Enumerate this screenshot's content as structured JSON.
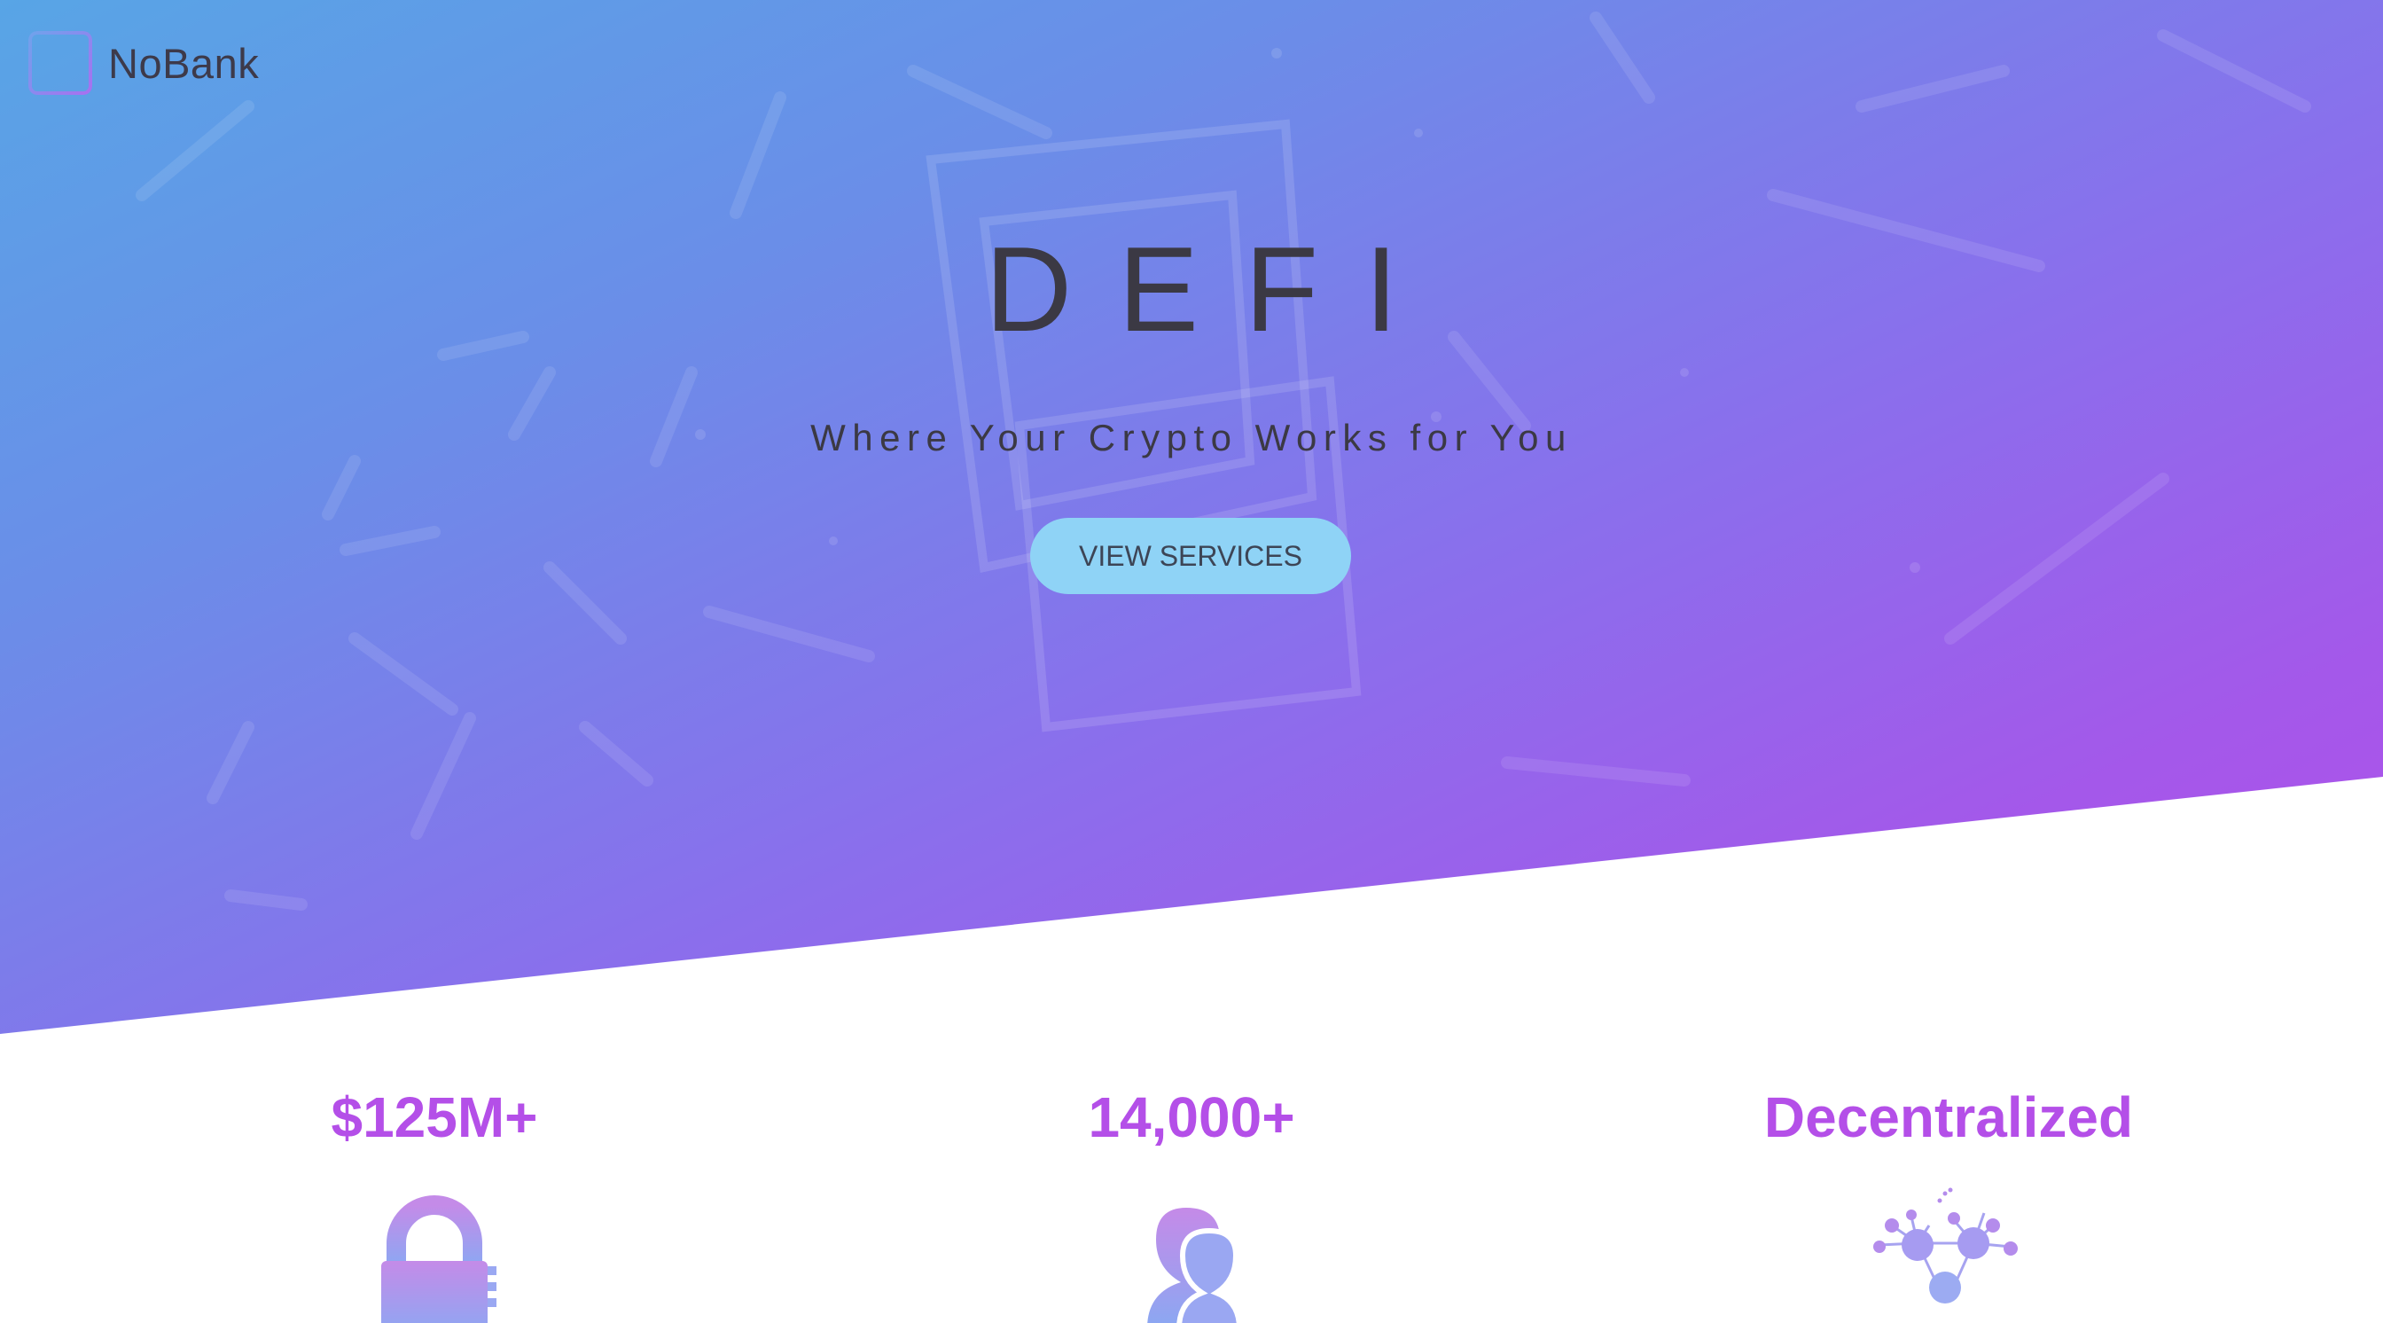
{
  "brand": {
    "name": "NoBank",
    "logo_icon": "rounded-square-outline-icon"
  },
  "hero": {
    "title": "DEFI",
    "subtitle": "Where Your Crypto Works for You",
    "cta_label": "VIEW SERVICES"
  },
  "stats": [
    {
      "value": "$125M+",
      "icon": "padlock-icon"
    },
    {
      "value": "14,000+",
      "icon": "users-icon"
    },
    {
      "value": "Decentralized",
      "icon": "network-nodes-icon"
    }
  ],
  "colors": {
    "hero_gradient_start": "#58a5e6",
    "hero_gradient_end": "#b150e9",
    "accent": "#b44fe8",
    "cta_background": "#8fd3f6",
    "heading_text": "#3b3944"
  }
}
